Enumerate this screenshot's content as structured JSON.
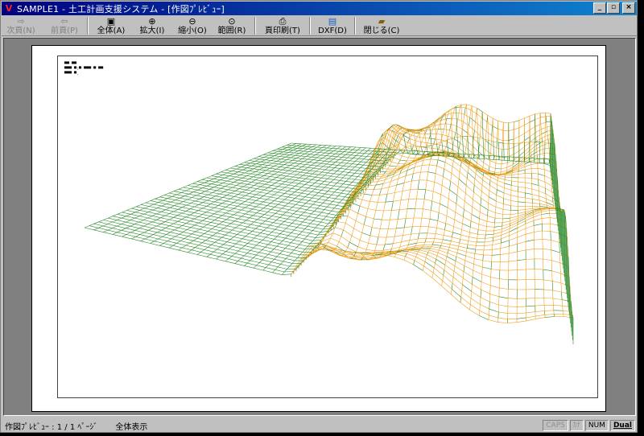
{
  "window": {
    "title": "SAMPLE1 - 土工計画支援システム - [作図ﾌﾟﾚﾋﾞｭｰ]",
    "controls": [
      "_",
      "▫",
      "×"
    ]
  },
  "toolbar": {
    "next": "次頁(N)",
    "prev": "前頁(P)",
    "all": "全体(A)",
    "zoom_in": "拡大(I)",
    "zoom_out": "縮小(O)",
    "range": "範囲(R)",
    "print": "頁印刷(T)",
    "dxf": "DXF(D)",
    "close": "閉じる(C)"
  },
  "paper": {
    "info_lines": [
      "▀▀ ▀▀",
      "▀▀▀ ▀:▀ ▀▀▀ ▀ ▀▀",
      "▀▀▀ ▀."
    ]
  },
  "mesh": {
    "ground_color": "#2e8b2e",
    "terrain_color": "#f0a020"
  },
  "status": {
    "page_info": "作図ﾌﾟﾚﾋﾞｭｰ : 1 / 1 ﾍﾟｰｼﾞ",
    "mode": "全体表示",
    "caps": "CAPS",
    "kana": "ｶﾅ",
    "num": "NUM",
    "dual": "Dual"
  }
}
